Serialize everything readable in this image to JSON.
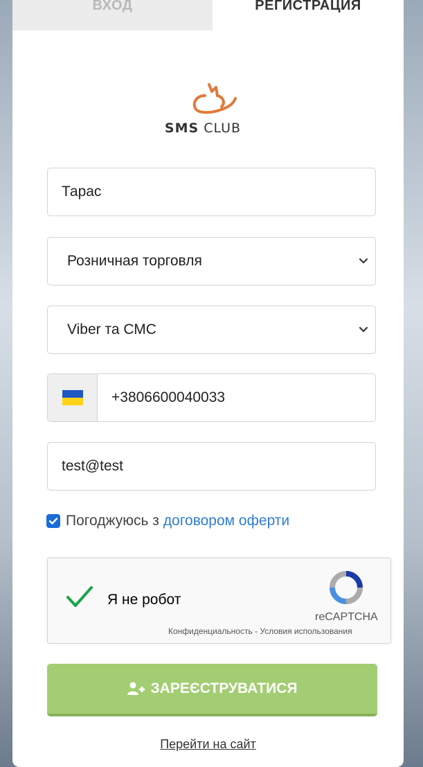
{
  "tabs": {
    "login": "ВХОД",
    "register": "РЕГИСТРАЦИЯ"
  },
  "logo": {
    "text_bold": "SMS",
    "text_light": "CLUB"
  },
  "form": {
    "name_value": "Тарас",
    "industry_value": "Розничная торговля",
    "channel_value": "Viber та СМС",
    "phone_value": "+3806600040033",
    "email_value": "test@test",
    "agree_text": "Погоджуюсь з",
    "agree_link": "договором оферти",
    "submit_label": "ЗАРЕЄСТРУВАТИСЯ",
    "site_link": "Перейти на сайт"
  },
  "captcha": {
    "label": "Я не робот",
    "brand": "reCAPTCHA",
    "links": "Конфиденциальность - Условия использования"
  },
  "colors": {
    "accent_green": "#a3cd72",
    "link_blue": "#2f7dd3",
    "checkbox_blue": "#1a6cd9"
  }
}
